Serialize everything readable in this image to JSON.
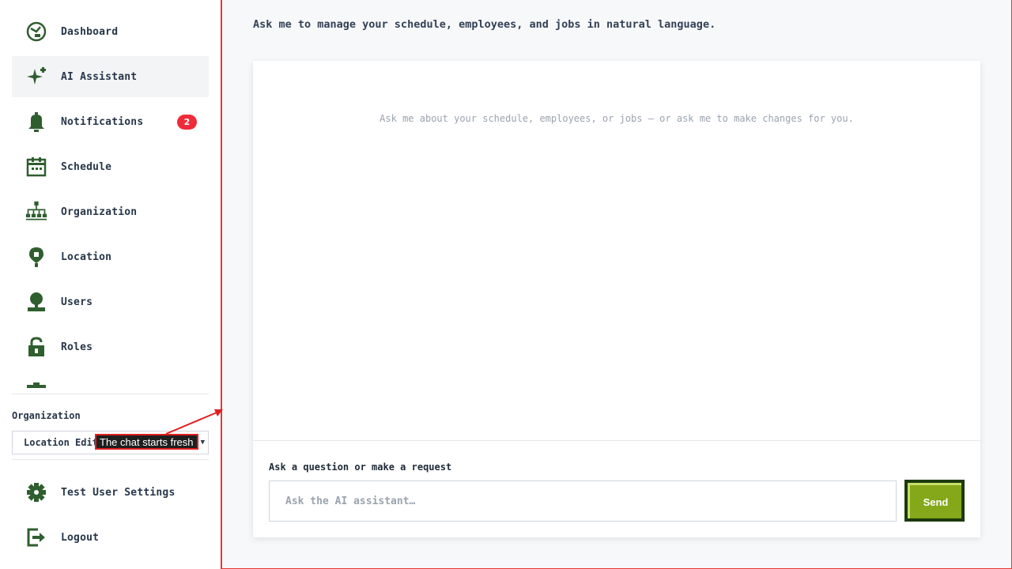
{
  "sidebar": {
    "items": [
      {
        "id": "dashboard",
        "label": "Dashboard",
        "icon": "dashboard-icon"
      },
      {
        "id": "ai-assistant",
        "label": "AI Assistant",
        "icon": "sparkle-icon",
        "active": true
      },
      {
        "id": "notifications",
        "label": "Notifications",
        "icon": "bell-icon",
        "badge": "2"
      },
      {
        "id": "schedule",
        "label": "Schedule",
        "icon": "calendar-icon"
      },
      {
        "id": "organization",
        "label": "Organization",
        "icon": "org-chart-icon"
      },
      {
        "id": "location",
        "label": "Location",
        "icon": "map-pin-icon"
      },
      {
        "id": "users",
        "label": "Users",
        "icon": "user-icon"
      },
      {
        "id": "roles",
        "label": "Roles",
        "icon": "lock-icon"
      }
    ],
    "org_label": "Organization",
    "org_select_value": "Location Edit",
    "bottom": [
      {
        "id": "test-user-settings",
        "label": "Test User Settings",
        "icon": "gear-icon"
      },
      {
        "id": "logout",
        "label": "Logout",
        "icon": "logout-icon"
      }
    ]
  },
  "tooltip": "The chat starts fresh",
  "main": {
    "subtitle": "Ask me to manage your schedule, employees, and jobs in natural language.",
    "empty_message": "Ask me about your schedule, employees, or jobs — or ask me to make changes for you.",
    "input_label": "Ask a question or make a request",
    "input_placeholder": "Ask the AI assistant…",
    "input_value": "",
    "send_label": "Send"
  },
  "colors": {
    "icon": "#2f5e2f",
    "badge": "#ef2b3a",
    "send": "#84a81a",
    "send_border": "#1c3a0e",
    "annotation": "#e02020"
  }
}
